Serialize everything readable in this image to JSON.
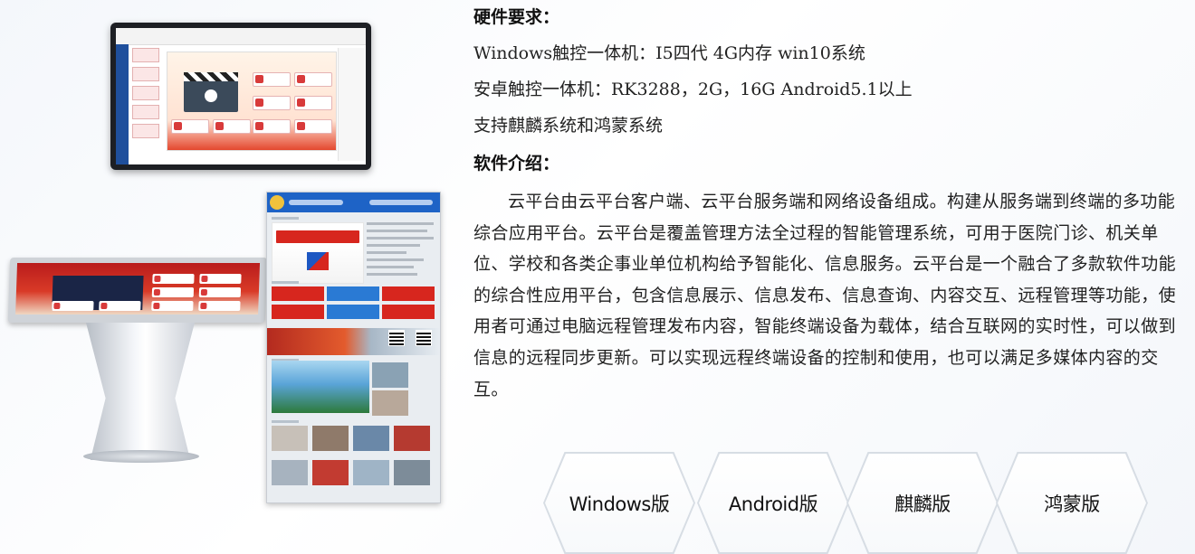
{
  "hardware": {
    "heading": "硬件要求：",
    "lines": [
      "Windows触控一体机：I5四代 4G内存 win10系统",
      "安卓触控一体机：RK3288，2G，16G Android5.1以上",
      "支持麒麟系统和鸿蒙系统"
    ]
  },
  "software": {
    "heading": "软件介绍：",
    "paragraph": "云平台由云平台客户端、云平台服务端和网络设备组成。构建从服务端到终端的多功能综合应用平台。云平台是覆盖管理方法全过程的智能管理系统，可用于医院门诊、机关单位、学校和各类企事业单位机构给予智能化、信息服务。云平台是一个融合了多款软件功能的综合性应用平台，包含信息展示、信息发布、信息查询、内容交互、远程管理等功能，使用者可通过电脑远程管理发布内容，智能终端设备为载体，结合互联网的实时性，可以做到信息的远程同步更新。可以实现远程终端设备的控制和使用，也可以满足多媒体内容的交互。"
  },
  "versions": [
    {
      "label": "Windows版"
    },
    {
      "label": "Android版"
    },
    {
      "label": "麒麟版"
    },
    {
      "label": "鸿蒙版"
    }
  ]
}
